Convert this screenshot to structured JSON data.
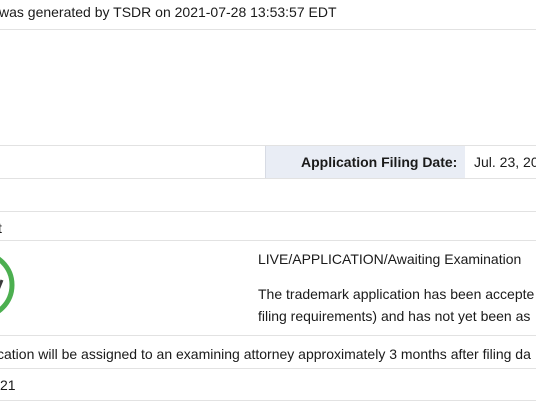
{
  "header": {
    "generated_text": "was generated by TSDR on 2021-07-28 13:53:57 EDT"
  },
  "filing": {
    "label": "Application Filing Date:",
    "value": "Jul. 23, 20"
  },
  "section": {
    "fragment": "t"
  },
  "status": {
    "title": "LIVE/APPLICATION/Awaiting Examination",
    "description_line1": "The trademark application has been accepte",
    "description_line2": "filing requirements) and has not yet been as",
    "icon": "check-circle-icon",
    "icon_color": "#4caf50"
  },
  "note": {
    "text": "cation will be assigned to an examining attorney approximately 3 months after filing da"
  },
  "bottom": {
    "fragment": "21"
  }
}
